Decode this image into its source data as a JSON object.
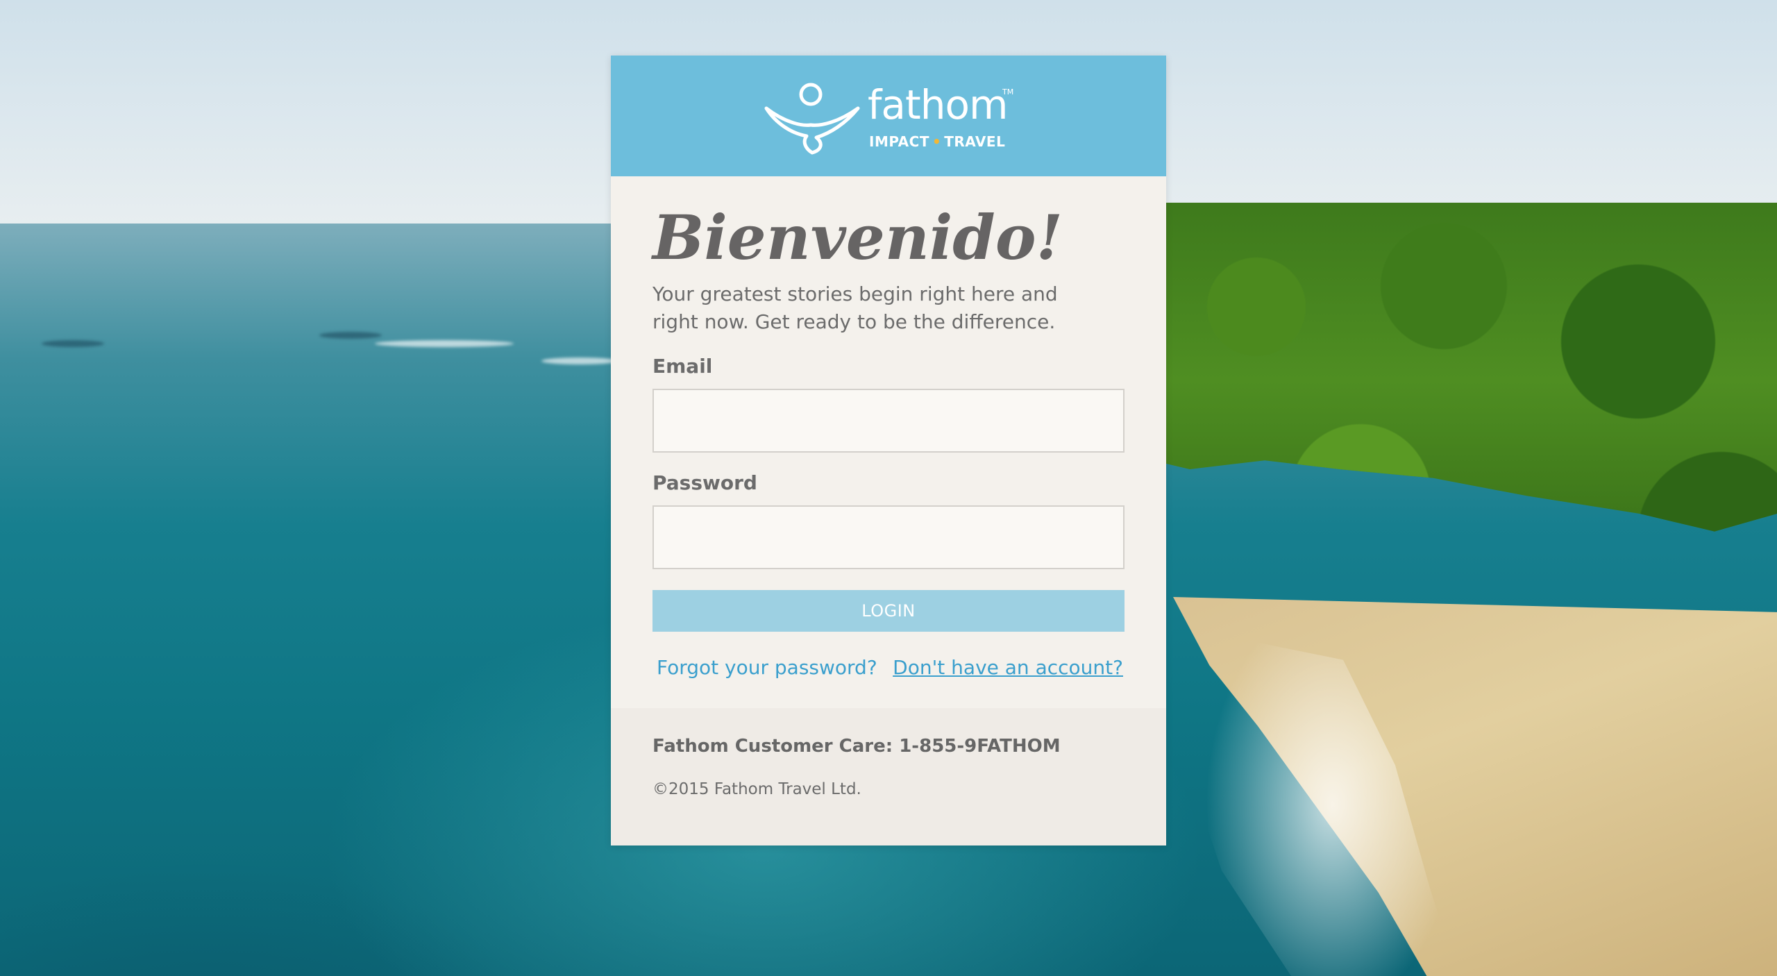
{
  "brand": {
    "name": "fathom",
    "trademark": "TM",
    "tagline_left": "IMPACT",
    "tagline_sep": "•",
    "tagline_right": "TRAVEL",
    "header_color": "#6dbedc",
    "accent_dot_color": "#f2b735"
  },
  "login": {
    "heading": "Bienvenido!",
    "intro": "Your greatest stories begin right here and right now. Get ready to be the difference.",
    "email_label": "Email",
    "email_value": "",
    "email_placeholder": "",
    "password_label": "Password",
    "password_value": "",
    "password_placeholder": "",
    "login_button": "LOGIN",
    "forgot_link": "Forgot your password?",
    "signup_link": "Don't have an account?",
    "button_color": "#9dd0e2",
    "link_color": "#3a9fcd"
  },
  "footer": {
    "customer_care": "Fathom Customer Care: 1-855-9FATHOM",
    "copyright": "©2015 Fathom Travel Ltd."
  },
  "background": {
    "icon": "beach-photo"
  }
}
